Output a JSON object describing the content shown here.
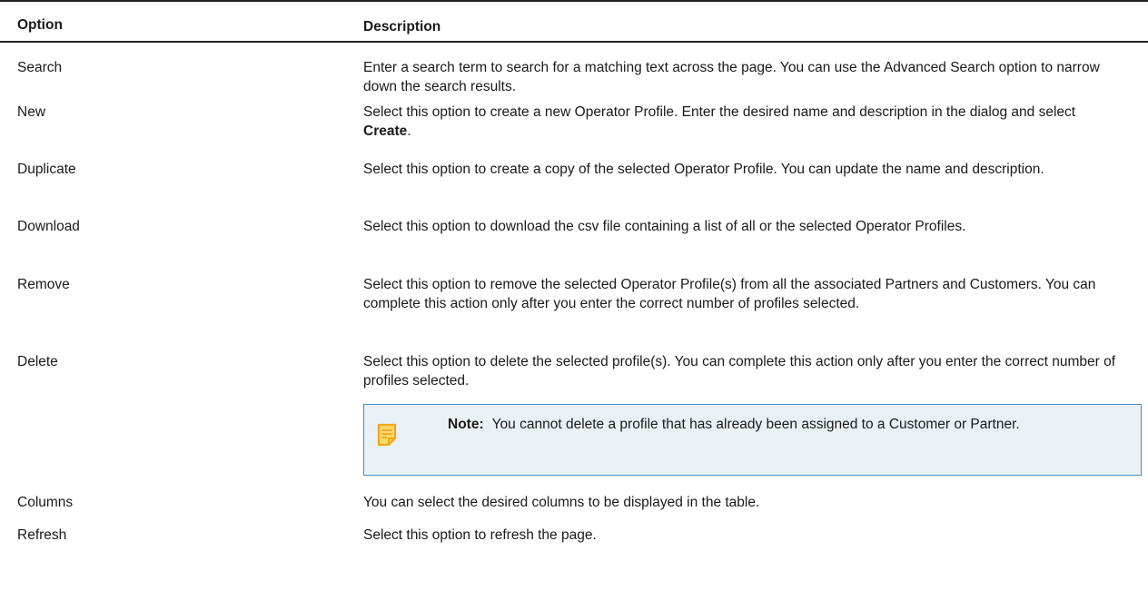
{
  "table": {
    "headers": {
      "option": "Option",
      "description": "Description"
    },
    "rows": [
      {
        "option": "Search",
        "description": "Enter a search term to search for a matching text across the page. You can use the Advanced Search option to narrow down the search results."
      },
      {
        "option": "New",
        "description_prefix": "Select this option to create a new Operator Profile. Enter the desired name and description in the dialog and select ",
        "description_bold": "Create",
        "description_suffix": "."
      },
      {
        "option": "Duplicate",
        "description": "Select this option to create a copy of the selected Operator Profile. You can update the name and description."
      },
      {
        "option": "Download",
        "description": "Select this option to download the csv file containing a list of all or the selected Operator Profiles."
      },
      {
        "option": "Remove",
        "description": "Select this option to remove the selected Operator Profile(s) from all the associated Partners and Customers. You can complete this action only after you enter the correct number of profiles selected."
      },
      {
        "option": "Delete",
        "description": "Select this option to delete the selected profile(s). You can complete this action only after you enter the correct number of profiles selected.",
        "note": {
          "label": "Note:",
          "text": "You cannot delete a profile that has already been assigned to a Customer or Partner.",
          "icon": "note-icon"
        }
      },
      {
        "option": "Columns",
        "description": "You can select the desired columns to be displayed in the table."
      },
      {
        "option": "Refresh",
        "description": "Select this option to refresh the page."
      }
    ]
  },
  "colors": {
    "note_border": "#4a8ec2",
    "note_background": "#e9f1f6",
    "note_icon": "#f2b233",
    "rule": "#222222"
  }
}
